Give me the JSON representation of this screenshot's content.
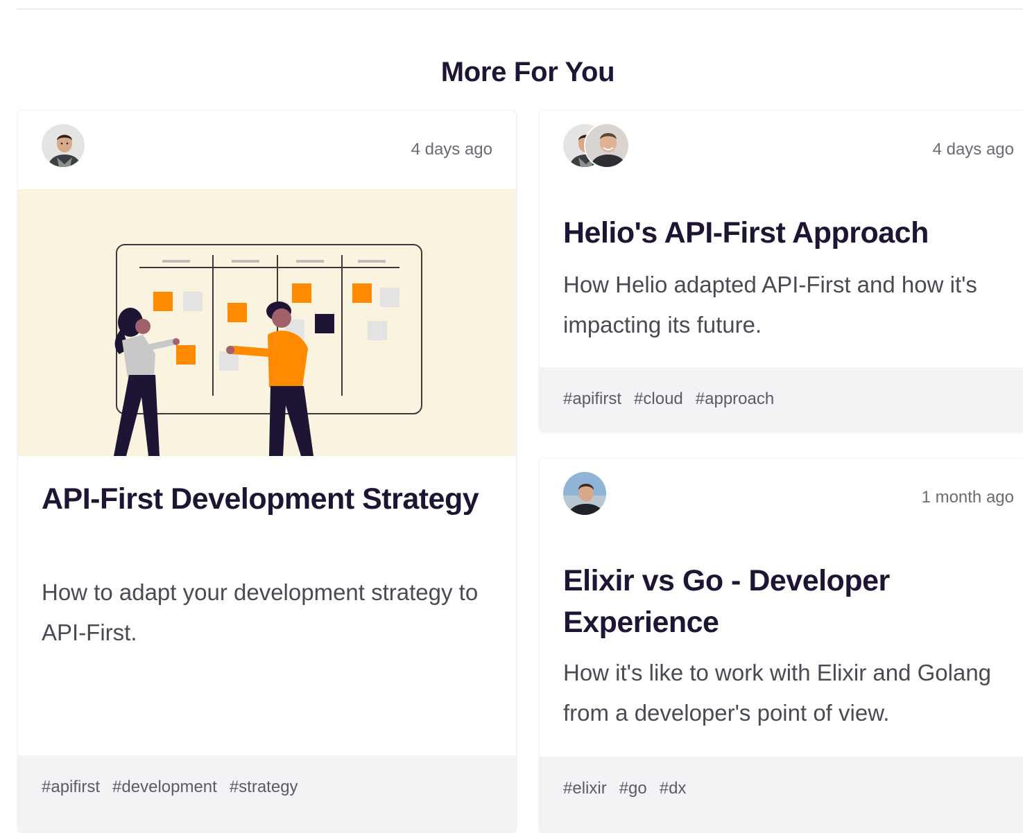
{
  "section": {
    "title": "More For You"
  },
  "cards": [
    {
      "time": "4 days ago",
      "title": "API-First Development Strategy",
      "description": "How to adapt your development strategy to API-First.",
      "tags": [
        "#apifirst",
        "#development",
        "#strategy"
      ]
    },
    {
      "time": "4 days ago",
      "title": "Helio's API-First Approach",
      "description": "How Helio adapted API-First and how it's impacting its future.",
      "tags": [
        "#apifirst",
        "#cloud",
        "#approach"
      ]
    },
    {
      "time": "1 month ago",
      "title": "Elixir vs Go - Developer Experience",
      "description": "How it's like to work with Elixir and Golang from a developer's point of view.",
      "tags": [
        "#elixir",
        "#go",
        "#dx"
      ]
    }
  ],
  "colors": {
    "heading": "#1e1433",
    "accent_orange": "#ff8a00",
    "illustration_bg": "#f9f3df",
    "tag_bar": "#f3f3f5"
  }
}
